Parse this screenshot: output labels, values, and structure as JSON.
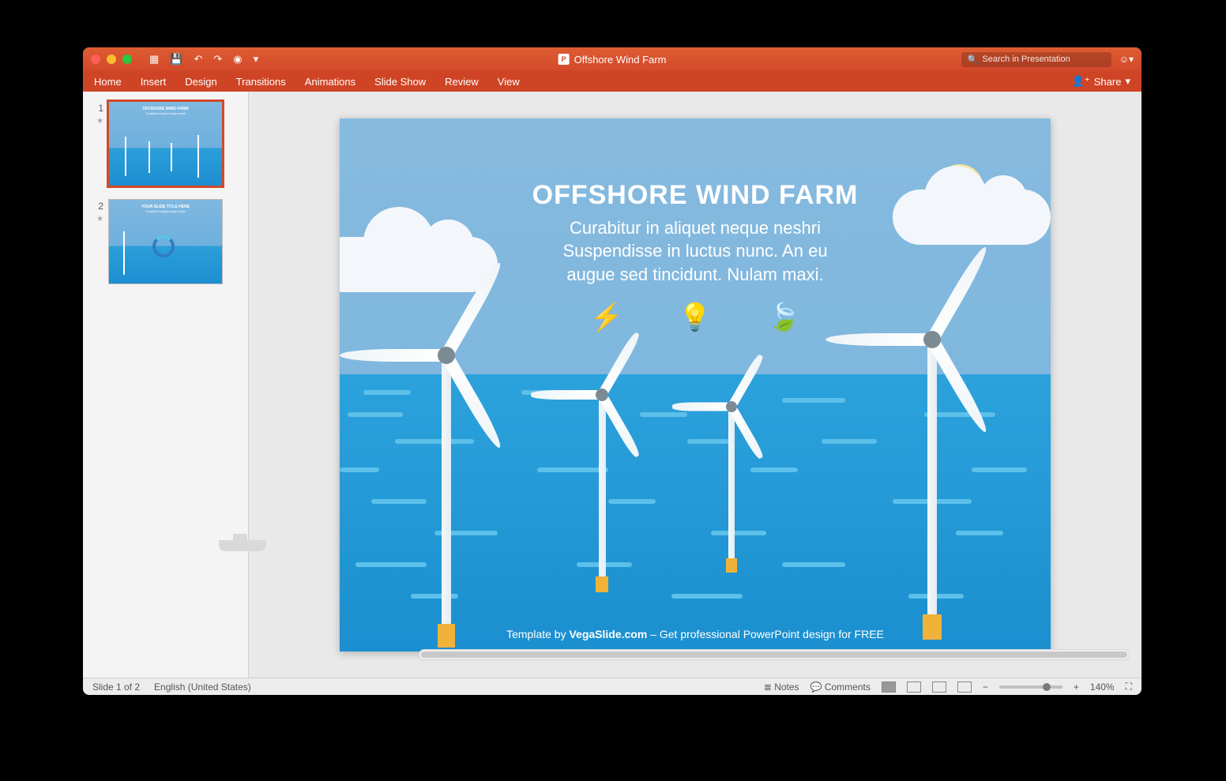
{
  "titlebar": {
    "doc_title": "Offshore Wind Farm"
  },
  "search": {
    "placeholder": "Search in Presentation"
  },
  "ribbon": {
    "tabs": [
      "Home",
      "Insert",
      "Design",
      "Transitions",
      "Animations",
      "Slide Show",
      "Review",
      "View"
    ],
    "share": "Share"
  },
  "thumbs": {
    "items": [
      {
        "num": "1",
        "title": "OFFSHORE WIND FARM",
        "sub": "Curabitur in aliquet neque neshri",
        "selected": true
      },
      {
        "num": "2",
        "title": "YOUR SLIDE TITLE HERE",
        "sub": "Curabitur in aliquet neque neshri",
        "selected": false
      }
    ]
  },
  "slide": {
    "headline": "OFFSHORE WIND FARM",
    "sub_l1": "Curabitur in aliquet neque neshri",
    "sub_l2": "Suspendisse in luctus nunc. An eu",
    "sub_l3": "augue sed tincidunt. Nulam maxi.",
    "footer_pre": "Template by ",
    "footer_link": "VegaSlide.com",
    "footer_post": " – Get professional PowerPoint design for FREE"
  },
  "status": {
    "slide_counter": "Slide 1 of 2",
    "language": "English (United States)",
    "notes": "Notes",
    "comments": "Comments",
    "zoom": "140%"
  }
}
